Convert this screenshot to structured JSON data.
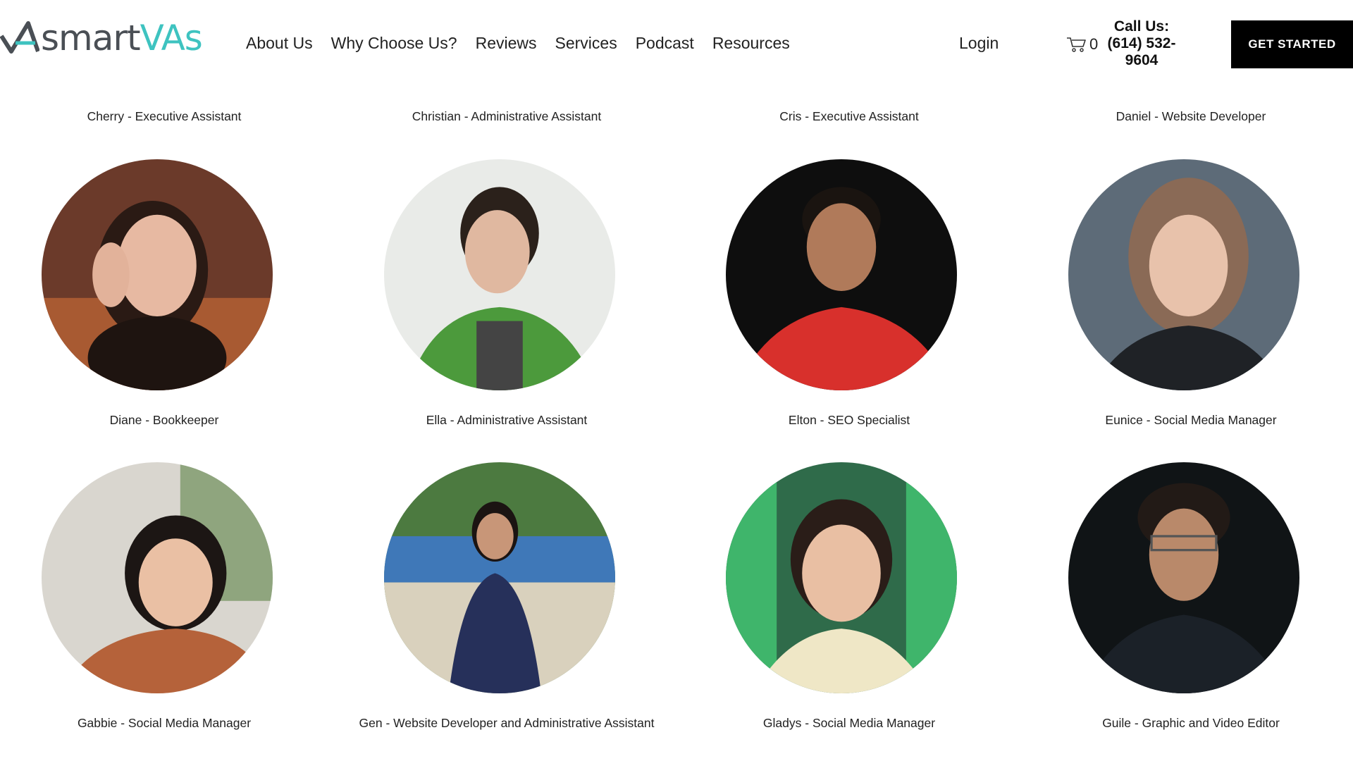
{
  "header": {
    "logo": {
      "part1": "smart",
      "part2": "VAs"
    },
    "nav": [
      "About Us",
      "Why Choose Us?",
      "Reviews",
      "Services",
      "Podcast",
      "Resources"
    ],
    "login": "Login",
    "cart": {
      "icon": "cart-icon",
      "count": "0"
    },
    "call": {
      "label": "Call Us:",
      "number_line1": "(614) 532-",
      "number_line2": "9604"
    },
    "cta": "GET STARTED"
  },
  "top_captions": [
    "Cherry - Executive Assistant",
    "Christian - Administrative Assistant",
    "Cris - Executive Assistant",
    "Daniel - Website Developer"
  ],
  "team_row1": [
    {
      "caption": "Diane - Bookkeeper"
    },
    {
      "caption": "Ella - Administrative Assistant"
    },
    {
      "caption": "Elton - SEO Specialist"
    },
    {
      "caption": "Eunice - Social Media Manager"
    }
  ],
  "team_row2": [
    {
      "caption": "Gabbie - Social Media Manager"
    },
    {
      "caption": "Gen - Website Developer and Administrative Assistant"
    },
    {
      "caption": "Gladys - Social Media Manager"
    },
    {
      "caption": "Guile - Graphic and Video Editor"
    }
  ],
  "colors": {
    "accent": "#3ec3c0",
    "logo_gray": "#4a4f55",
    "cta_bg": "#000000"
  }
}
